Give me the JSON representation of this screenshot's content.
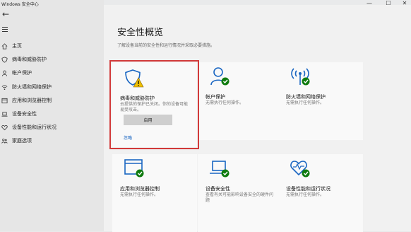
{
  "window": {
    "title": "Windows 安全中心",
    "controls": {
      "minimize": "—",
      "maximize": "☐",
      "close": "✕"
    }
  },
  "sidebar": {
    "back": "←",
    "items": [
      {
        "label": "主页",
        "icon": "home-icon"
      },
      {
        "label": "病毒和威胁防护",
        "icon": "shield-icon"
      },
      {
        "label": "帐户保护",
        "icon": "person-icon"
      },
      {
        "label": "防火墙和网络保护",
        "icon": "wifi-icon"
      },
      {
        "label": "应用和浏览器控制",
        "icon": "browser-icon"
      },
      {
        "label": "设备安全性",
        "icon": "laptop-icon"
      },
      {
        "label": "设备性能和运行状况",
        "icon": "heart-icon"
      },
      {
        "label": "家庭选项",
        "icon": "family-icon"
      }
    ]
  },
  "main": {
    "title": "安全性概览",
    "subtitle": "了解设备当前的安全性和运行情况并采取必要措施。",
    "tiles": [
      {
        "title": "病毒和威胁防护",
        "desc": "云提供的保护已关闭。你的设备可能易受攻击。",
        "status": "warning",
        "icon": "shield-warning-icon",
        "button": "启用",
        "link": "忽略"
      },
      {
        "title": "帐户保护",
        "desc": "无需执行任何操作。",
        "status": "ok",
        "icon": "person-check-icon"
      },
      {
        "title": "防火墙和网络保护",
        "desc": "无需执行任何操作。",
        "status": "ok",
        "icon": "wifi-check-icon"
      },
      {
        "title": "应用和浏览器控制",
        "desc": "无需执行任何操作。",
        "status": "ok",
        "icon": "browser-check-icon"
      },
      {
        "title": "设备安全性",
        "desc": "查看有关可能影响设备安全的硬件问题",
        "status": "ok",
        "icon": "laptop-check-icon"
      },
      {
        "title": "设备性能和运行状况",
        "desc": "无需执行任何操作。",
        "status": "ok",
        "icon": "heart-check-icon"
      }
    ]
  },
  "colors": {
    "accent_blue": "#1a66c2",
    "ok_green": "#0f7b0f",
    "warning_yellow": "#f0c000",
    "highlight_red": "#d23a3a"
  }
}
